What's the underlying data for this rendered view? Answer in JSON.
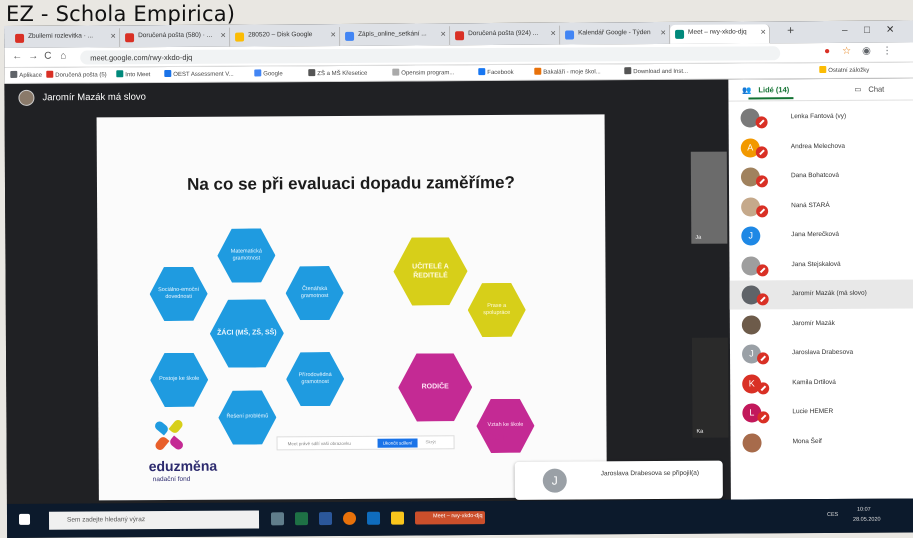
{
  "caption": "EZ - Schola Empirica)",
  "browser": {
    "tabs": [
      {
        "label": "Zbuilemi rozlevitka · ...",
        "color": "#d93025"
      },
      {
        "label": "Doručená pošta (580) · ...",
        "color": "#d93025"
      },
      {
        "label": "280520 – Disk Google",
        "color": "#fbbc04"
      },
      {
        "label": "Zápis_online_setkání ...",
        "color": "#4285f4"
      },
      {
        "label": "Doručená pošta (924) ...",
        "color": "#d93025"
      },
      {
        "label": "Kalendář Google - Týden",
        "color": "#4285f4"
      },
      {
        "label": "Meet – rwy-xkdo-djq",
        "color": "#00897b"
      }
    ],
    "new_tab": "+",
    "window_controls": [
      "–",
      "□",
      "✕"
    ],
    "nav": [
      "←",
      "→",
      "C",
      "⌂"
    ],
    "url": "meet.google.com/rwy-xkdo-djq",
    "bookmarks": [
      {
        "label": "Aplikace",
        "color": "#5f6368"
      },
      {
        "label": "Doručená pošta (5)",
        "color": "#d93025"
      },
      {
        "label": "Into Meet",
        "color": "#00897b"
      },
      {
        "label": "OEST Assessment V...",
        "color": "#1a73e8"
      },
      {
        "label": "Google",
        "color": "#4285f4"
      },
      {
        "label": "ZŠ a MŠ Křesetice",
        "color": "#555"
      },
      {
        "label": "Opensim program...",
        "color": "#aaa"
      },
      {
        "label": "Facebook",
        "color": "#1877f2"
      },
      {
        "label": "Bakaláři - moje škol...",
        "color": "#e8710a"
      },
      {
        "label": "Download and Inst...",
        "color": "#555"
      },
      {
        "label": "Ostatní záložky",
        "color": "#fbbc04"
      }
    ]
  },
  "meet": {
    "speaker": "Jaromír Mazák má slovo",
    "slide": {
      "title": "Na co se při evaluaci dopadu zaměříme?",
      "blue": [
        "Matematická gramotnost",
        "Sociálno-emoční dovednosti",
        "Čtenářská gramotnost",
        "ŽÁCI (MŠ, ZŠ, SŠ)",
        "Postoje ke škole",
        "Přírodovědná gramotnost",
        "Řešení problémů"
      ],
      "yellow": [
        "UČITELÉ A ŘEDITELÉ",
        "Praxe a spolupráce"
      ],
      "magenta": [
        "RODIČE",
        "Vztah ke škole"
      ],
      "brand": "eduzměna",
      "brand_sub": "nadační fond",
      "present_bar": "Meet právě sdílí vaši obrazovku",
      "stop_button": "Ukončit sdílení",
      "hide_button": "Skrýt",
      "cih": "ČCIH"
    },
    "toast": {
      "initial": "J",
      "text": "Jaroslava Drabesova se připojil(a)"
    },
    "tiles": [
      {
        "label": "Ja"
      },
      {
        "label": "Ka"
      }
    ]
  },
  "panel": {
    "people_tab": "Lidé (14)",
    "chat_tab": "Chat",
    "people": [
      {
        "initial": "",
        "name": "Lenka Fantová (vy)",
        "color": "#7a7a7a",
        "muted": true,
        "highlight": false
      },
      {
        "initial": "A",
        "name": "Andrea Melechova",
        "color": "#f29900",
        "muted": true,
        "highlight": false
      },
      {
        "initial": "",
        "name": "Dana Bohatcová",
        "color": "#a0825e",
        "muted": true,
        "highlight": false
      },
      {
        "initial": "",
        "name": "Naná STARÁ",
        "color": "#c5a98b",
        "muted": true,
        "highlight": false
      },
      {
        "initial": "J",
        "name": "Jana Merečková",
        "color": "#1e88e5",
        "muted": false,
        "highlight": false
      },
      {
        "initial": "",
        "name": "Jana Stejskalová",
        "color": "#9e9e9e",
        "muted": true,
        "highlight": false
      },
      {
        "initial": "",
        "name": "Jaromír Mazák (má slovo)",
        "color": "#5f6368",
        "muted": true,
        "highlight": true
      },
      {
        "initial": "",
        "name": "Jaromír Mazák",
        "color": "#6d5b4a",
        "muted": false,
        "highlight": false
      },
      {
        "initial": "J",
        "name": "Jaroslava Drabesova",
        "color": "#9aa0a6",
        "muted": true,
        "highlight": false
      },
      {
        "initial": "K",
        "name": "Kamila Drtilová",
        "color": "#d93025",
        "muted": true,
        "highlight": false
      },
      {
        "initial": "L",
        "name": "Lucie HEMER",
        "color": "#c2185b",
        "muted": true,
        "highlight": false
      },
      {
        "initial": "",
        "name": "Mona Šeif",
        "color": "#a76b4b",
        "muted": false,
        "highlight": false
      }
    ]
  },
  "taskbar": {
    "search_placeholder": "Sem zadejte hledaný výraz",
    "time": "10:07",
    "date": "28.05.2020",
    "lang": "CES",
    "meet_item": "Meet – rwy-xkdo-djq"
  }
}
